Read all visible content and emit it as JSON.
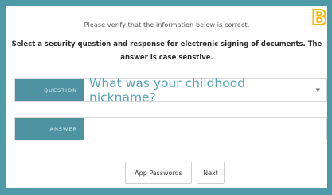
{
  "intro_text": "Please verify that the information below is correct.",
  "instructions": "Select a security question and response for electronic signing of documents. The answer is case senstive.",
  "badge_letter": "B",
  "question": {
    "label": "QUESTION",
    "selected": "What was your childhood nickname?"
  },
  "answer": {
    "label": "ANSWER",
    "value": ""
  },
  "buttons": {
    "app_passwords": "App Passwords",
    "next": "Next"
  },
  "colors": {
    "background": "#4f9aa8",
    "label_bg": "#4f93a2",
    "select_text": "#55a4b4",
    "badge": "#f5b800"
  }
}
